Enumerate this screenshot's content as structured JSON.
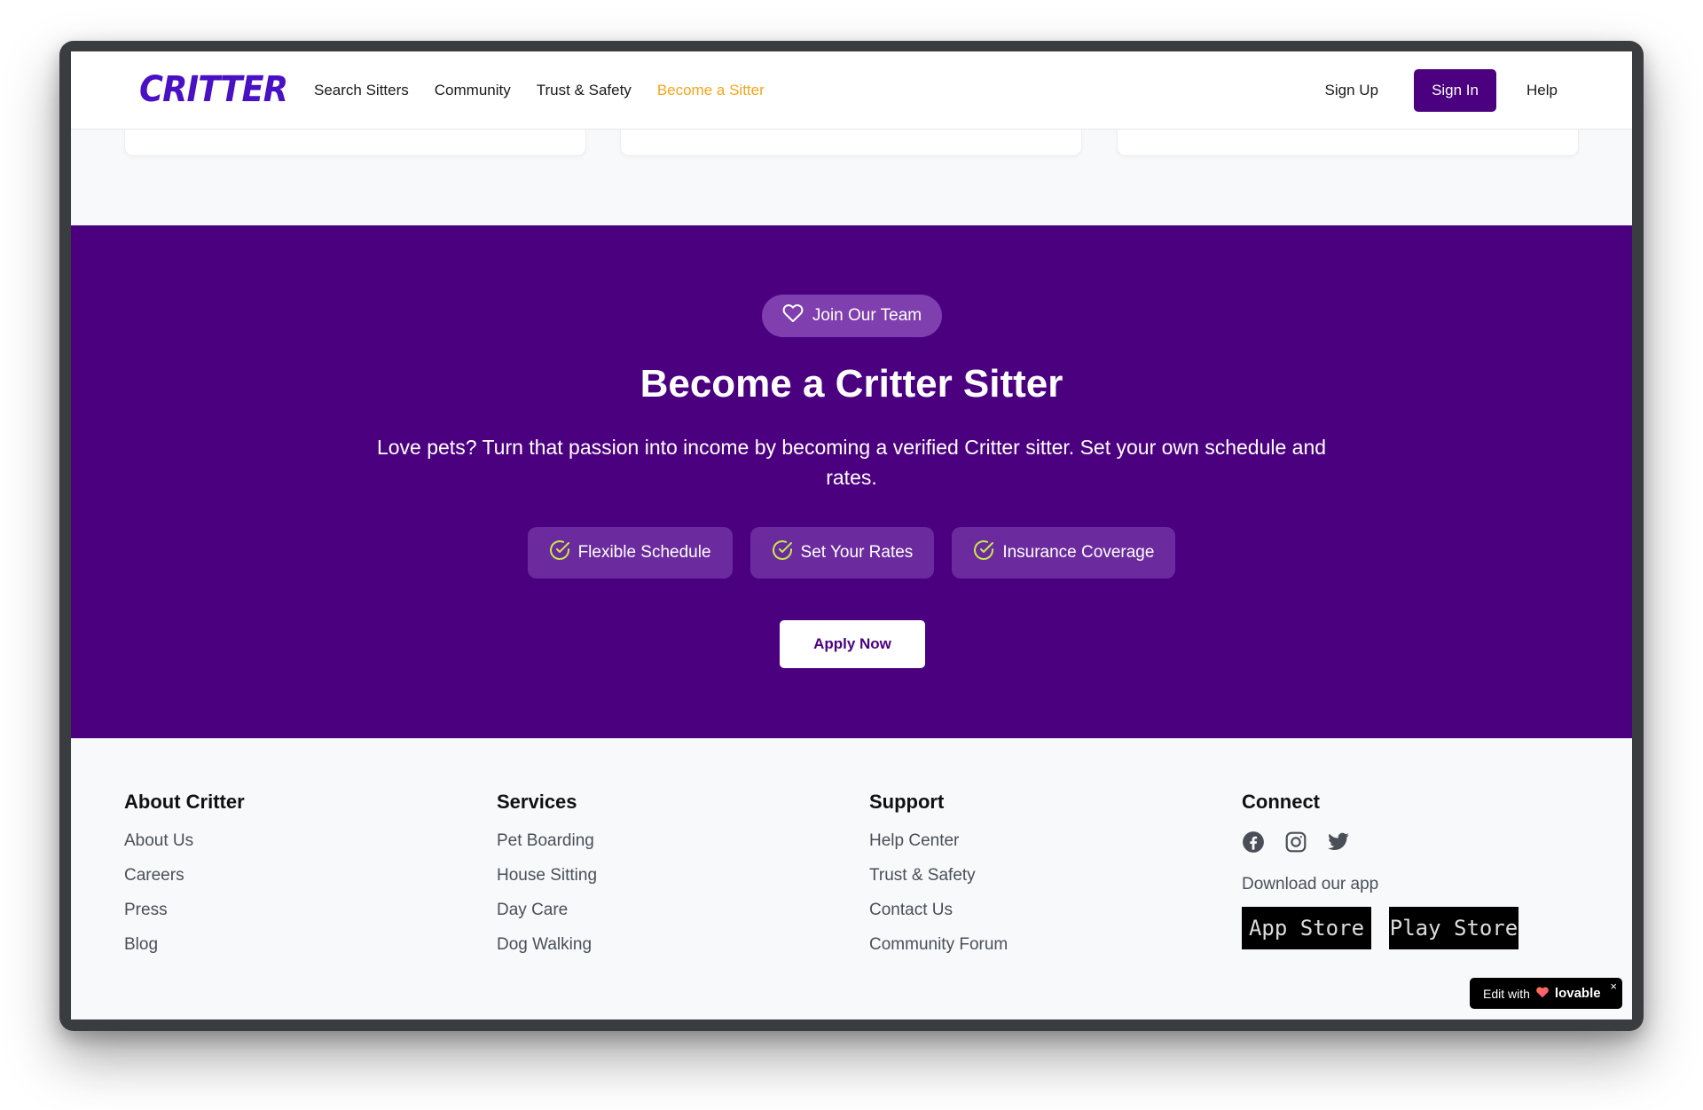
{
  "header": {
    "logo": "CRITTER",
    "nav": [
      "Search Sitters",
      "Community",
      "Trust & Safety",
      "Become a Sitter"
    ],
    "signup": "Sign Up",
    "signin": "Sign In",
    "help": "Help"
  },
  "hero": {
    "badge": "Join Our Team",
    "title": "Become a Critter Sitter",
    "description": "Love pets? Turn that passion into income by becoming a verified Critter sitter. Set your own schedule and rates.",
    "features": [
      "Flexible Schedule",
      "Set Your Rates",
      "Insurance Coverage"
    ],
    "apply": "Apply Now"
  },
  "footer": {
    "about": {
      "title": "About Critter",
      "links": [
        "About Us",
        "Careers",
        "Press",
        "Blog"
      ]
    },
    "services": {
      "title": "Services",
      "links": [
        "Pet Boarding",
        "House Sitting",
        "Day Care",
        "Dog Walking"
      ]
    },
    "support": {
      "title": "Support",
      "links": [
        "Help Center",
        "Trust & Safety",
        "Contact Us",
        "Community Forum"
      ]
    },
    "connect": {
      "title": "Connect",
      "social": [
        "facebook-icon",
        "instagram-icon",
        "twitter-icon"
      ],
      "download_label": "Download our app",
      "stores": [
        "App Store",
        "Play Store"
      ]
    }
  },
  "lovable": {
    "prefix": "Edit with",
    "brand": "lovable",
    "close": "×"
  },
  "colors": {
    "brand_purple": "#4b0080",
    "logo_purple": "#4a10c4",
    "accent": "#f5a51b",
    "check": "#c7e84a"
  }
}
